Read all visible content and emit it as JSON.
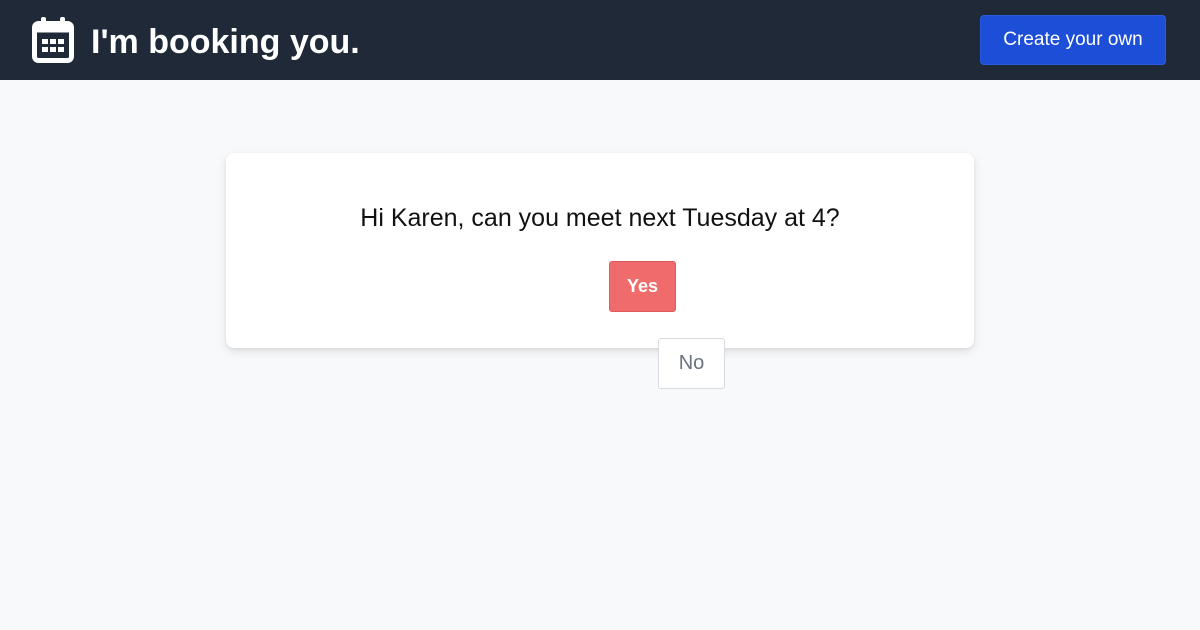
{
  "header": {
    "title": "I'm booking you.",
    "icon": "calendar-icon",
    "create_label": "Create your own"
  },
  "card": {
    "question": "Hi Karen, can you meet next Tuesday at 4?",
    "yes_label": "Yes",
    "no_label": "No"
  },
  "colors": {
    "header_bg": "#1f2937",
    "primary": "#1d4ed8",
    "yes": "#f06b6b",
    "page_bg": "#f8f9fb"
  }
}
